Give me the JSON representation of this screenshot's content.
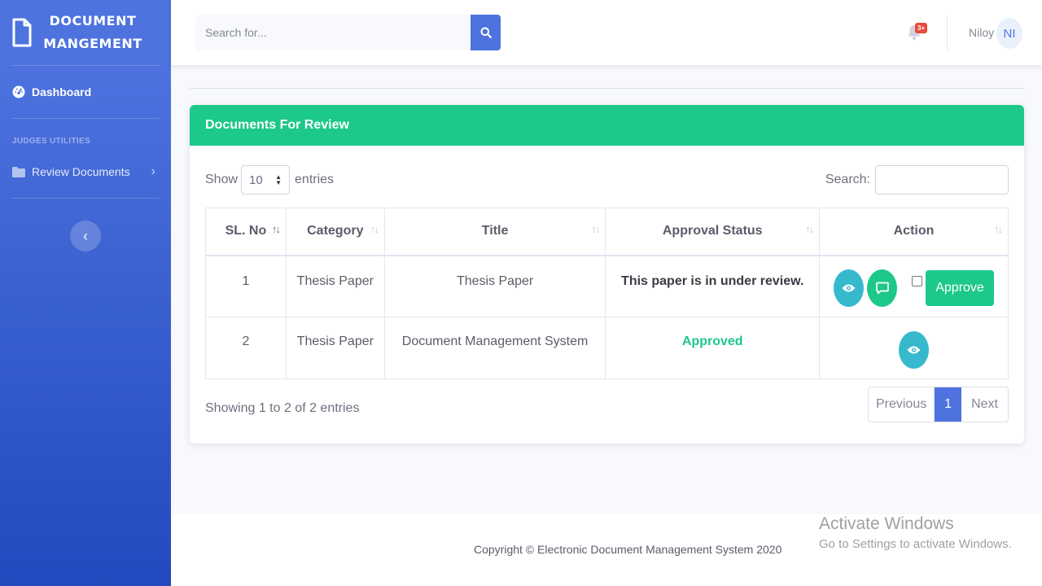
{
  "sidebar": {
    "brand_line1": "DOCUMENT",
    "brand_line2": "MANGEMENT",
    "dashboard_label": "Dashboard",
    "section_heading": "JUDGES UTILITIES",
    "review_label": "Review Documents",
    "toggle_icon": "‹"
  },
  "topbar": {
    "search_placeholder": "Search for...",
    "alert_count": "3+",
    "user_name": "Niloy",
    "avatar_initials": "NI"
  },
  "card": {
    "title": "Documents For Review",
    "show_label": "Show",
    "entries_value": "10",
    "entries_label": "entries",
    "search_label": "Search:",
    "columns": [
      "SL. No",
      "Category",
      "Title",
      "Approval Status",
      "Action"
    ],
    "rows": [
      {
        "sl": "1",
        "category": "Thesis Paper",
        "title": "Thesis Paper",
        "status": "This paper is in under review.",
        "approve_label": "Approve"
      },
      {
        "sl": "2",
        "category": "Thesis Paper",
        "title": "Document Management System",
        "status": "Approved"
      }
    ],
    "info": "Showing 1 to 2 of 2 entries",
    "pagination": {
      "previous": "Previous",
      "current": "1",
      "next": "Next"
    }
  },
  "footer": {
    "copyright": "Copyright © Electronic Document Management System 2020"
  },
  "watermark": {
    "title": "Activate Windows",
    "subtitle": "Go to Settings to activate Windows."
  },
  "colors": {
    "sidebar_top": "#4e73df",
    "sidebar_bottom": "#224abe",
    "card_header": "#1cc88a",
    "info_button": "#36b9cc",
    "primary": "#4e73df",
    "danger_badge": "#e74a3b"
  },
  "icons": {
    "brand": "file-icon",
    "dashboard": "tachometer-icon",
    "review": "folder-icon",
    "search": "search-icon",
    "alerts": "bell-icon",
    "view": "eye-icon",
    "comment": "comment-icon"
  }
}
